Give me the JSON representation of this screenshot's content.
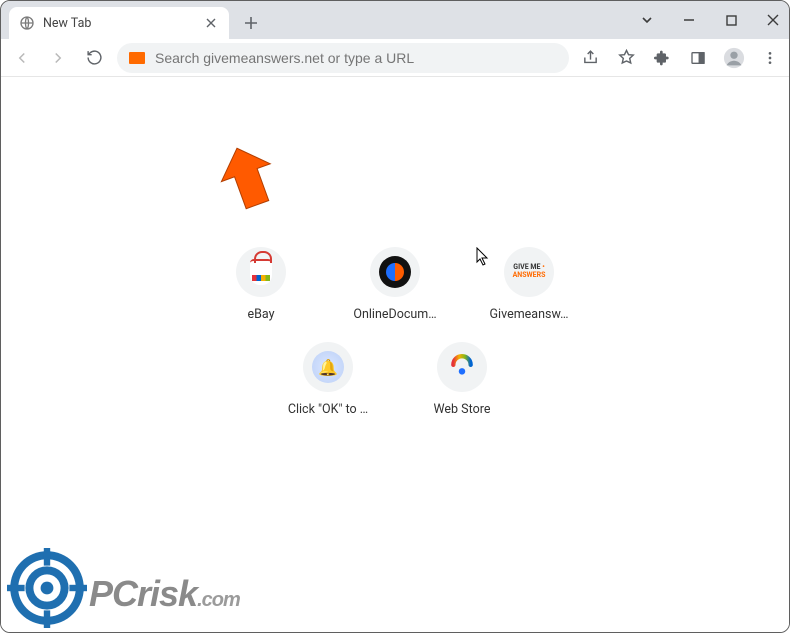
{
  "window": {
    "tab_title": "New Tab"
  },
  "toolbar": {
    "omnibox_placeholder": "Search givemeanswers.net or type a URL"
  },
  "shortcuts": {
    "row1": [
      {
        "label": "eBay"
      },
      {
        "label": "OnlineDocum…"
      },
      {
        "label": "Givemeansw…"
      }
    ],
    "row2": [
      {
        "label": "Click \"OK\" to …"
      },
      {
        "label": "Web Store"
      }
    ]
  },
  "watermark": {
    "text_main": "PCrisk",
    "text_suffix": ".com"
  },
  "givemeanswers_icon": {
    "line1": "GIVE ME",
    "line2": "ANSWERS"
  }
}
